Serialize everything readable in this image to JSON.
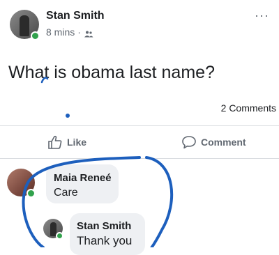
{
  "post": {
    "author": "Stan Smith",
    "time": "8 mins",
    "dot": "·",
    "privacy_icon": "friends-icon",
    "text": "What is obama last name?",
    "comments_count": "2 Comments",
    "more": "···"
  },
  "actions": {
    "like_label": "Like",
    "comment_label": "Comment"
  },
  "comments": [
    {
      "author": "Maia Reneé",
      "text": "Care"
    },
    {
      "author": "Stan Smith",
      "text": "Thank you"
    }
  ],
  "colors": {
    "accent": "#1877f2",
    "online": "#31a24c",
    "annotation": "#1d5fbd"
  }
}
